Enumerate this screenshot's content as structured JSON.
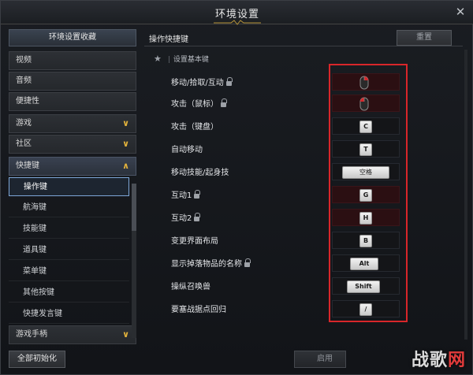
{
  "window": {
    "title": "环境设置"
  },
  "sidebar": {
    "header": "环境设置收藏",
    "items": [
      {
        "label": "视频",
        "chevron": ""
      },
      {
        "label": "音频",
        "chevron": ""
      },
      {
        "label": "便捷性",
        "chevron": ""
      },
      {
        "label": "游戏",
        "chevron": "∨"
      },
      {
        "label": "社区",
        "chevron": "∨"
      },
      {
        "label": "快捷键",
        "chevron": "∧"
      }
    ],
    "sub_items": [
      {
        "label": "操作键"
      },
      {
        "label": "航海键"
      },
      {
        "label": "技能键"
      },
      {
        "label": "道具键"
      },
      {
        "label": "菜单键"
      },
      {
        "label": "其他按键"
      },
      {
        "label": "快捷发言键"
      }
    ],
    "last_item": {
      "label": "游戏手柄",
      "chevron": "∨"
    },
    "reset_all_label": "全部初始化"
  },
  "main": {
    "title": "操作快捷键",
    "reset_label": "重置",
    "section_label": "设置基本键",
    "rows": [
      {
        "label": "移动/拾取/互动",
        "locked": true,
        "key": "",
        "icon": "mouse-right-icon"
      },
      {
        "label": "攻击（鼠标）",
        "locked": true,
        "key": "",
        "icon": "mouse-left-icon"
      },
      {
        "label": "攻击（键盘）",
        "locked": false,
        "key": "C"
      },
      {
        "label": "自动移动",
        "locked": false,
        "key": "T"
      },
      {
        "label": "移动技能/起身技",
        "locked": false,
        "key": "空格"
      },
      {
        "label": "互动1",
        "locked": true,
        "key": "G"
      },
      {
        "label": "互动2",
        "locked": true,
        "key": "H"
      },
      {
        "label": "变更界面布局",
        "locked": false,
        "key": "B"
      },
      {
        "label": "显示掉落物品的名称",
        "locked": true,
        "key": "Alt"
      },
      {
        "label": "操纵召唤兽",
        "locked": false,
        "key": "Shift"
      },
      {
        "label": "要塞战据点回归",
        "locked": false,
        "key": "/"
      }
    ],
    "apply_label": "启用"
  },
  "watermark": {
    "text_a": "战歌",
    "text_b": "网"
  },
  "colors": {
    "accent": "#e2b23c",
    "highlight": "#d8262a",
    "selected_border": "#7ea7d8"
  }
}
